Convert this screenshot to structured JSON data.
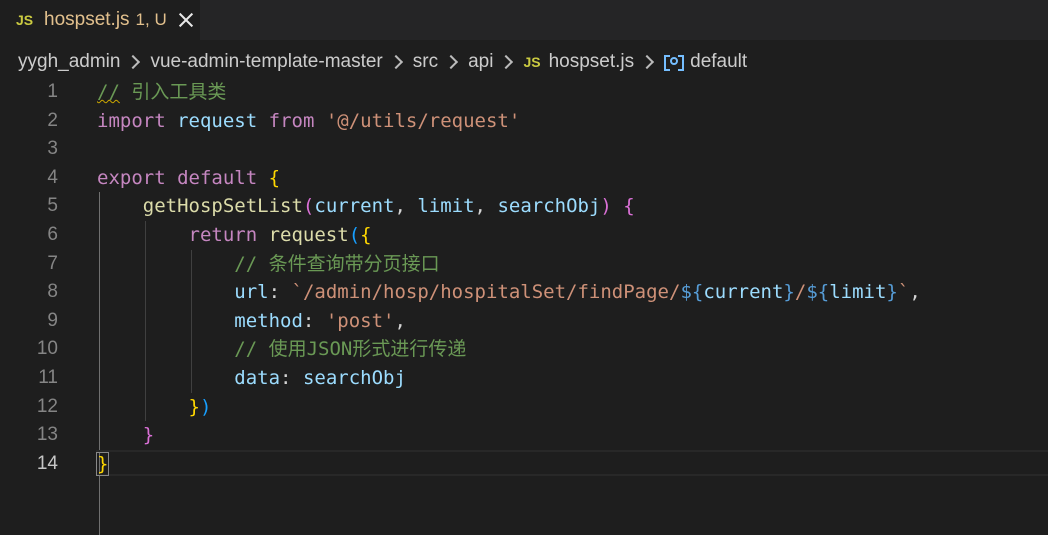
{
  "tab": {
    "lang_badge": "JS",
    "file_name": "hospset.js",
    "status": "1, U"
  },
  "breadcrumb": {
    "items": [
      "yygh_admin",
      "vue-admin-template-master",
      "src",
      "api"
    ],
    "file_badge": "JS",
    "file_name": "hospset.js",
    "symbol": "default"
  },
  "editor": {
    "active_line": 14,
    "lines": [
      {
        "n": "1",
        "tokens": [
          [
            "cm squiggle",
            "//"
          ],
          [
            "cm",
            " 引入工具类"
          ]
        ]
      },
      {
        "n": "2",
        "tokens": [
          [
            "kw",
            "import"
          ],
          [
            "punc",
            " "
          ],
          [
            "var",
            "request"
          ],
          [
            "punc",
            " "
          ],
          [
            "kw",
            "from"
          ],
          [
            "punc",
            " "
          ],
          [
            "str",
            "'@/utils/request'"
          ]
        ]
      },
      {
        "n": "3",
        "tokens": []
      },
      {
        "n": "4",
        "tokens": [
          [
            "kw",
            "export"
          ],
          [
            "punc",
            " "
          ],
          [
            "kw",
            "default"
          ],
          [
            "punc",
            " "
          ],
          [
            "br",
            "{"
          ]
        ]
      },
      {
        "n": "5",
        "tokens": [
          [
            "punc",
            "    "
          ],
          [
            "fn",
            "getHospSetList"
          ],
          [
            "br2",
            "("
          ],
          [
            "var",
            "current"
          ],
          [
            "punc",
            ", "
          ],
          [
            "var",
            "limit"
          ],
          [
            "punc",
            ", "
          ],
          [
            "var",
            "searchObj"
          ],
          [
            "br2",
            ")"
          ],
          [
            "punc",
            " "
          ],
          [
            "br2",
            "{"
          ]
        ]
      },
      {
        "n": "6",
        "tokens": [
          [
            "punc",
            "        "
          ],
          [
            "kw",
            "return"
          ],
          [
            "punc",
            " "
          ],
          [
            "fn",
            "request"
          ],
          [
            "br3",
            "("
          ],
          [
            "br",
            "{"
          ]
        ]
      },
      {
        "n": "7",
        "tokens": [
          [
            "punc",
            "            "
          ],
          [
            "cm",
            "// 条件查询带分页接口"
          ]
        ]
      },
      {
        "n": "8",
        "tokens": [
          [
            "punc",
            "            "
          ],
          [
            "var",
            "url"
          ],
          [
            "punc",
            ": "
          ],
          [
            "str",
            "`/admin/hosp/hospitalSet/findPage/"
          ],
          [
            "tpl",
            "${"
          ],
          [
            "var",
            "current"
          ],
          [
            "tpl",
            "}"
          ],
          [
            "str",
            "/"
          ],
          [
            "tpl",
            "${"
          ],
          [
            "var",
            "limit"
          ],
          [
            "tpl",
            "}"
          ],
          [
            "str",
            "`"
          ],
          [
            "punc",
            ","
          ]
        ]
      },
      {
        "n": "9",
        "tokens": [
          [
            "punc",
            "            "
          ],
          [
            "var",
            "method"
          ],
          [
            "punc",
            ": "
          ],
          [
            "str",
            "'post'"
          ],
          [
            "punc",
            ","
          ]
        ]
      },
      {
        "n": "10",
        "tokens": [
          [
            "punc",
            "            "
          ],
          [
            "cm",
            "// 使用JSON形式进行传递"
          ]
        ]
      },
      {
        "n": "11",
        "tokens": [
          [
            "punc",
            "            "
          ],
          [
            "var",
            "data"
          ],
          [
            "punc",
            ": "
          ],
          [
            "var",
            "searchObj"
          ]
        ]
      },
      {
        "n": "12",
        "tokens": [
          [
            "punc",
            "        "
          ],
          [
            "br",
            "}"
          ],
          [
            "br3",
            ")"
          ]
        ]
      },
      {
        "n": "13",
        "tokens": [
          [
            "punc",
            "    "
          ],
          [
            "br2",
            "}"
          ]
        ]
      },
      {
        "n": "14",
        "tokens": [
          [
            "br bracket-box",
            "}"
          ]
        ]
      }
    ]
  }
}
